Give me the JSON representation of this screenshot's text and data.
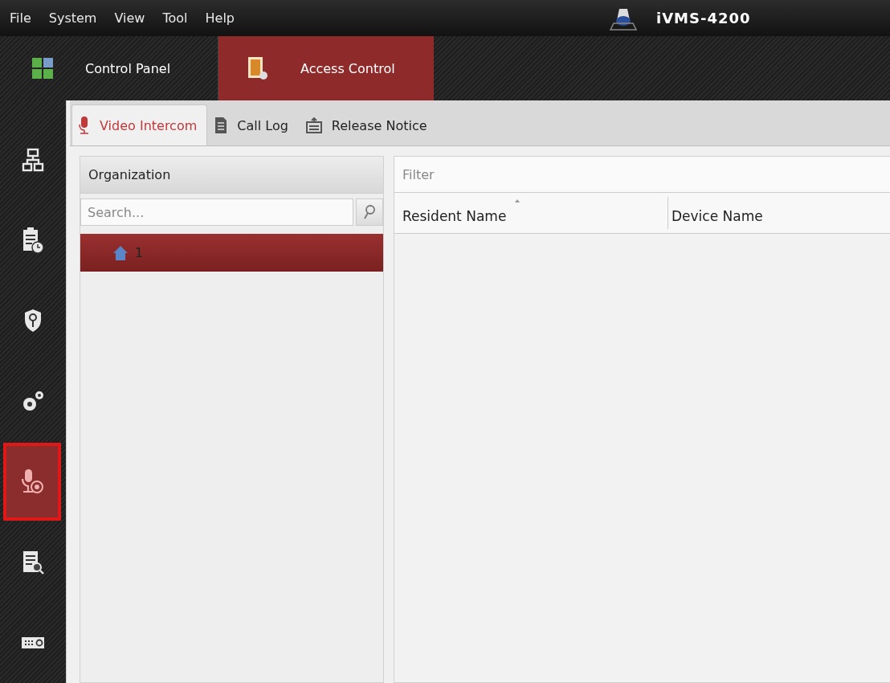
{
  "menu_bar": {
    "items": [
      "File",
      "System",
      "View",
      "Tool",
      "Help"
    ],
    "app_title": "iVMS-4200"
  },
  "module_tabs": [
    {
      "label": "Control Panel",
      "selected": false
    },
    {
      "label": "Access Control",
      "selected": true
    }
  ],
  "sidebar": {
    "items": [
      {
        "selected": false
      },
      {
        "selected": false
      },
      {
        "selected": false
      },
      {
        "selected": false
      },
      {
        "selected": true
      },
      {
        "selected": false
      },
      {
        "selected": false
      }
    ]
  },
  "sub_tabs": [
    {
      "label": "Video Intercom",
      "selected": true
    },
    {
      "label": "Call Log",
      "selected": false
    },
    {
      "label": "Release Notice",
      "selected": false
    }
  ],
  "organization": {
    "title": "Organization",
    "search_placeholder": "Search...",
    "tree": [
      {
        "label": "1",
        "selected": true
      }
    ]
  },
  "filter": {
    "placeholder": "Filter"
  },
  "table": {
    "columns": [
      {
        "label": "Resident Name",
        "sorted": true
      },
      {
        "label": "Device Name",
        "sorted": false
      }
    ]
  }
}
